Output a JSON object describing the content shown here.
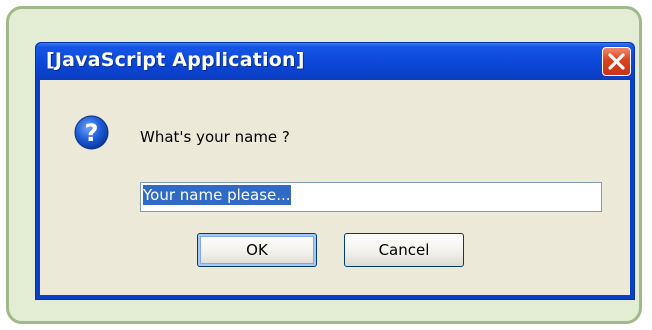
{
  "dialog": {
    "title": "[JavaScript Application]",
    "message": "What's your name ?",
    "input_value": "Your name please...",
    "ok_label": "OK",
    "cancel_label": "Cancel"
  },
  "icons": {
    "close": "close-icon",
    "question": "question-icon"
  },
  "colors": {
    "frame_border": "#9fb98a",
    "frame_fill": "#e3edd4",
    "titlebar": "#0c47d8",
    "close_button": "#d9431e",
    "client_bg": "#ece9d8",
    "selection": "#316ac5"
  }
}
